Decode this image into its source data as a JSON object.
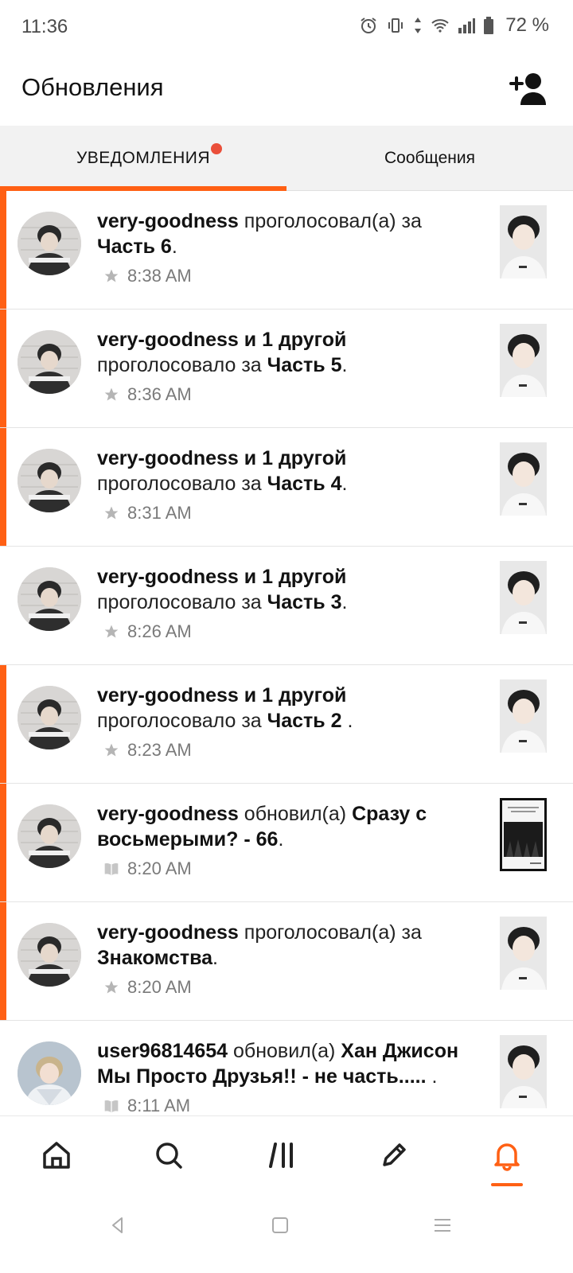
{
  "status_bar": {
    "time": "11:36",
    "battery": "72 %"
  },
  "header": {
    "title": "Обновления"
  },
  "tabs": [
    {
      "label": "УВЕДОМЛЕНИЯ",
      "active": true,
      "has_dot": true
    },
    {
      "label": "Сообщения",
      "active": false
    }
  ],
  "notifications": [
    {
      "user": "very-goodness",
      "action": " проголосовал(а) за ",
      "target": "Часть 6",
      "end": ".",
      "time": "8:38 AM",
      "meta_icon": "star-icon",
      "unread": true
    },
    {
      "user": "very-goodness и 1 другой",
      "action": " проголосовало за ",
      "target": "Часть 5",
      "end": ".",
      "time": "8:36 AM",
      "meta_icon": "star-icon",
      "unread": true
    },
    {
      "user": "very-goodness и 1 другой",
      "action": " проголосовало за ",
      "target": "Часть 4",
      "end": ".",
      "time": "8:31 AM",
      "meta_icon": "star-icon",
      "unread": true
    },
    {
      "user": "very-goodness и 1 другой",
      "action": " проголосовало за ",
      "target": "Часть 3",
      "end": ".",
      "time": "8:26 AM",
      "meta_icon": "star-icon",
      "unread": false
    },
    {
      "user": "very-goodness и 1 другой",
      "action": " проголосовало за ",
      "target": "Часть 2 ",
      "end": ".",
      "time": "8:23 AM",
      "meta_icon": "star-icon",
      "unread": true
    },
    {
      "user": "very-goodness",
      "action": " обновил(а) ",
      "target": "Сразу с восьмерыми? - 66",
      "end": ".",
      "time": "8:20 AM",
      "meta_icon": "book-icon",
      "unread": true
    },
    {
      "user": "very-goodness",
      "action": " проголосовал(а) за ",
      "target": "Знакомства",
      "end": ".",
      "time": "8:20 AM",
      "meta_icon": "star-icon",
      "unread": true
    },
    {
      "user": "user96814654",
      "action": " обновил(а) ",
      "target": "Хан Джисон Мы Просто Друзья!! - не часть..... ",
      "end": ".",
      "time": "8:11 AM",
      "meta_icon": "book-icon",
      "unread": false
    }
  ],
  "bottom_nav": [
    {
      "name": "home-icon"
    },
    {
      "name": "search-icon"
    },
    {
      "name": "library-icon"
    },
    {
      "name": "pencil-icon"
    },
    {
      "name": "bell-icon",
      "active": true
    }
  ],
  "colors": {
    "accent": "#ff6014",
    "dot": "#ea4f3a"
  }
}
